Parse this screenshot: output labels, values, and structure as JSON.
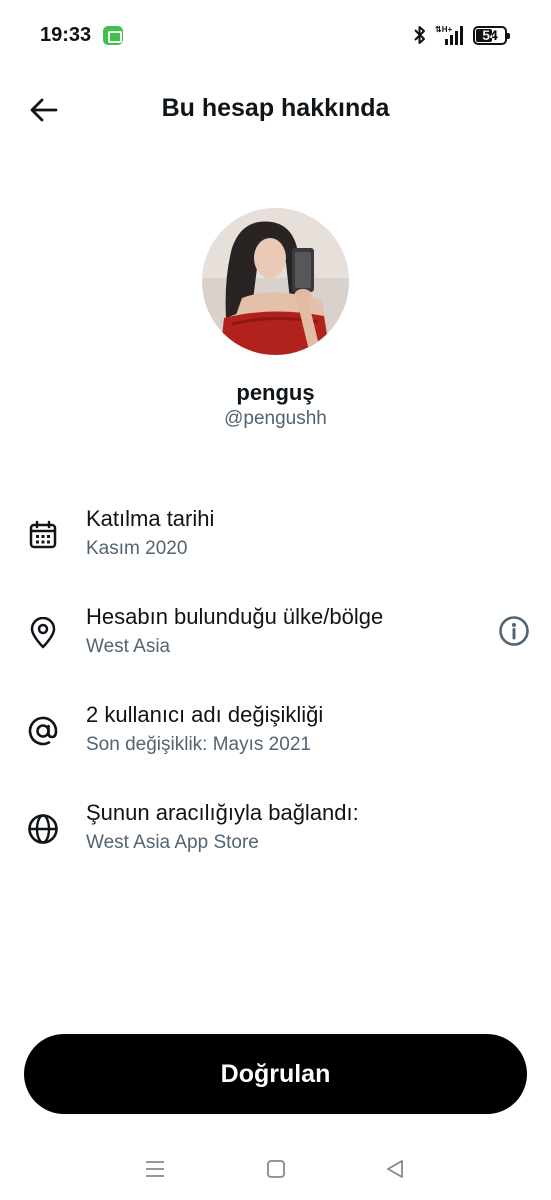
{
  "status_bar": {
    "time": "19:33",
    "battery": "54",
    "battery_level": 0.54,
    "icons": [
      "message-app-icon",
      "bluetooth-icon",
      "signal-icon",
      "battery-icon"
    ]
  },
  "header": {
    "title": "Bu hesap hakkında",
    "back_icon": "arrow-left-icon"
  },
  "profile": {
    "display_name": "penguş",
    "handle": "@pengushh"
  },
  "info": [
    {
      "icon": "calendar-icon",
      "title": "Katılma tarihi",
      "subtitle": "Kasım 2020"
    },
    {
      "icon": "location-pin-icon",
      "title": "Hesabın bulunduğu ülke/bölge",
      "subtitle": "West Asia",
      "help_icon": "info-circle-icon"
    },
    {
      "icon": "at-sign-icon",
      "title": "2 kullanıcı adı değişikliği",
      "subtitle": "Son değişiklik: Mayıs 2021"
    },
    {
      "icon": "globe-icon",
      "title": "Şunun aracılığıyla bağlandı:",
      "subtitle": "West Asia App Store"
    }
  ],
  "button": {
    "label": "Doğrulan"
  },
  "nav": [
    "menu-icon",
    "home-square-icon",
    "back-triangle-icon"
  ],
  "colors": {
    "text": "#0f1419",
    "secondary": "#536471",
    "button_bg": "#000000"
  }
}
